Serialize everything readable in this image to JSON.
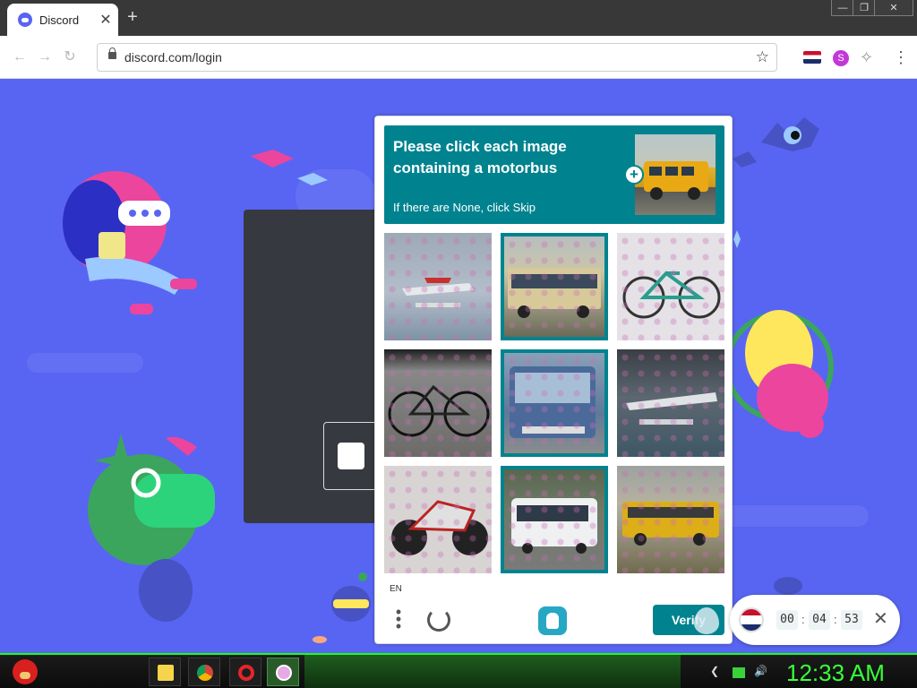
{
  "browser": {
    "tab_title": "Discord",
    "tab_close": "✕",
    "new_tab": "+",
    "url": "discord.com/login",
    "back": "←",
    "forward": "→",
    "reload": "↻",
    "star": "☆",
    "ext_s": "S",
    "ext_puzzle": "✧",
    "menu": "⋮",
    "minimize": "—",
    "maximize": "❐",
    "close": "✕"
  },
  "captcha": {
    "prompt_line1": "Please click each image",
    "prompt_line2": "containing a motorbus",
    "prompt_sub": "If there are None, click Skip",
    "plus": "+",
    "tiles": [
      {
        "label": "seaplane",
        "selected": false
      },
      {
        "label": "bus",
        "selected": true
      },
      {
        "label": "bicycle",
        "selected": false
      },
      {
        "label": "bicycle",
        "selected": false
      },
      {
        "label": "bus",
        "selected": true
      },
      {
        "label": "seaplane",
        "selected": false
      },
      {
        "label": "motorcycle",
        "selected": false
      },
      {
        "label": "bus",
        "selected": true
      },
      {
        "label": "school bus",
        "selected": false
      }
    ],
    "language": "EN",
    "verify_label": "Verify",
    "accent": "#00838f"
  },
  "timer": {
    "hours": "00",
    "minutes": "04",
    "seconds": "53",
    "sep": ":",
    "close": "✕"
  },
  "taskbar": {
    "clock": "12:33 AM",
    "accent": "#3aff3a"
  },
  "icons": [
    "discord-icon",
    "lock-icon",
    "star-icon",
    "puzzle-icon",
    "menu-icon",
    "refresh-icon",
    "hcaptcha-logo-icon",
    "flag-icon",
    "close-icon",
    "angry-bird-icon",
    "folder-icon",
    "chrome-icon",
    "opera-icon"
  ]
}
